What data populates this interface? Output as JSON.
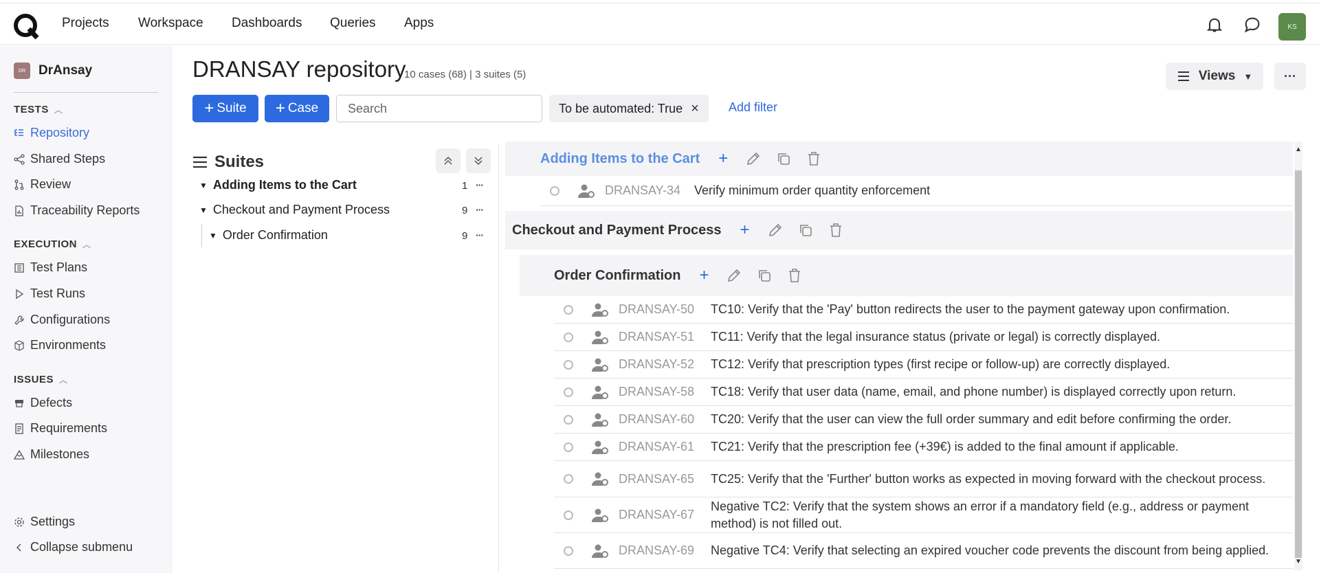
{
  "topnav": {
    "items": [
      "Projects",
      "Workspace",
      "Dashboards",
      "Queries",
      "Apps"
    ],
    "avatar_initials": "KS"
  },
  "sidebar": {
    "project_badge": "DR",
    "project_name": "DrAnsay",
    "sections": [
      {
        "title": "TESTS",
        "items": [
          "Repository",
          "Shared Steps",
          "Review",
          "Traceability Reports"
        ]
      },
      {
        "title": "EXECUTION",
        "items": [
          "Test Plans",
          "Test Runs",
          "Configurations",
          "Environments"
        ]
      },
      {
        "title": "ISSUES",
        "items": [
          "Defects",
          "Requirements",
          "Milestones"
        ]
      }
    ],
    "bottom": [
      "Settings",
      "Collapse submenu"
    ],
    "active_item": "Repository"
  },
  "header": {
    "title": "DRANSAY repository",
    "subtitle": "10 cases (68) | 3 suites (5)",
    "views_label": "Views",
    "more_label": "···"
  },
  "toolbar": {
    "suite_label": "Suite",
    "case_label": "Case",
    "search_placeholder": "Search",
    "filter_chip": "To be automated: True",
    "add_filter": "Add filter"
  },
  "suites_panel": {
    "heading": "Suites",
    "tree": [
      {
        "name": "Adding Items to the Cart",
        "count": "1",
        "bold": true
      },
      {
        "name": "Checkout and Payment Process",
        "count": "9",
        "bold": false
      },
      {
        "name": "Order Confirmation",
        "count": "9",
        "bold": false
      }
    ],
    "dots": "···"
  },
  "cases_panel": {
    "suites": [
      {
        "name": "Adding Items to the Cart"
      },
      {
        "name": "Checkout and Payment Process"
      },
      {
        "name": "Order Confirmation"
      }
    ],
    "cart_cases": [
      {
        "id": "DRANSAY-34",
        "title": "Verify minimum order quantity enforcement"
      }
    ],
    "confirmation_cases": [
      {
        "id": "DRANSAY-50",
        "title": "TC10: Verify that the 'Pay' button redirects the user to the payment gateway upon confirmation."
      },
      {
        "id": "DRANSAY-51",
        "title": "TC11: Verify that the legal insurance status (private or legal) is correctly displayed."
      },
      {
        "id": "DRANSAY-52",
        "title": "TC12: Verify that prescription types (first recipe or follow-up) are correctly displayed."
      },
      {
        "id": "DRANSAY-58",
        "title": "TC18: Verify that user data (name, email, and phone number) is displayed correctly upon return."
      },
      {
        "id": "DRANSAY-60",
        "title": "TC20: Verify that the user can view the full order summary and edit before confirming the order."
      },
      {
        "id": "DRANSAY-61",
        "title": "TC21: Verify that the prescription fee (+39€) is added to the final amount if applicable."
      },
      {
        "id": "DRANSAY-65",
        "title": "TC25: Verify that the 'Further' button works as expected in moving forward with the checkout process."
      },
      {
        "id": "DRANSAY-67",
        "title": "Negative TC2: Verify that the system shows an error if a mandatory field (e.g., address or payment method) is not filled out."
      },
      {
        "id": "DRANSAY-69",
        "title": "Negative TC4: Verify that selecting an expired voucher code prevents the discount from being applied."
      }
    ]
  },
  "colors": {
    "accent": "#2d6ae0",
    "active_link": "#3b6cd8",
    "avatar": "#5c8a4a"
  }
}
